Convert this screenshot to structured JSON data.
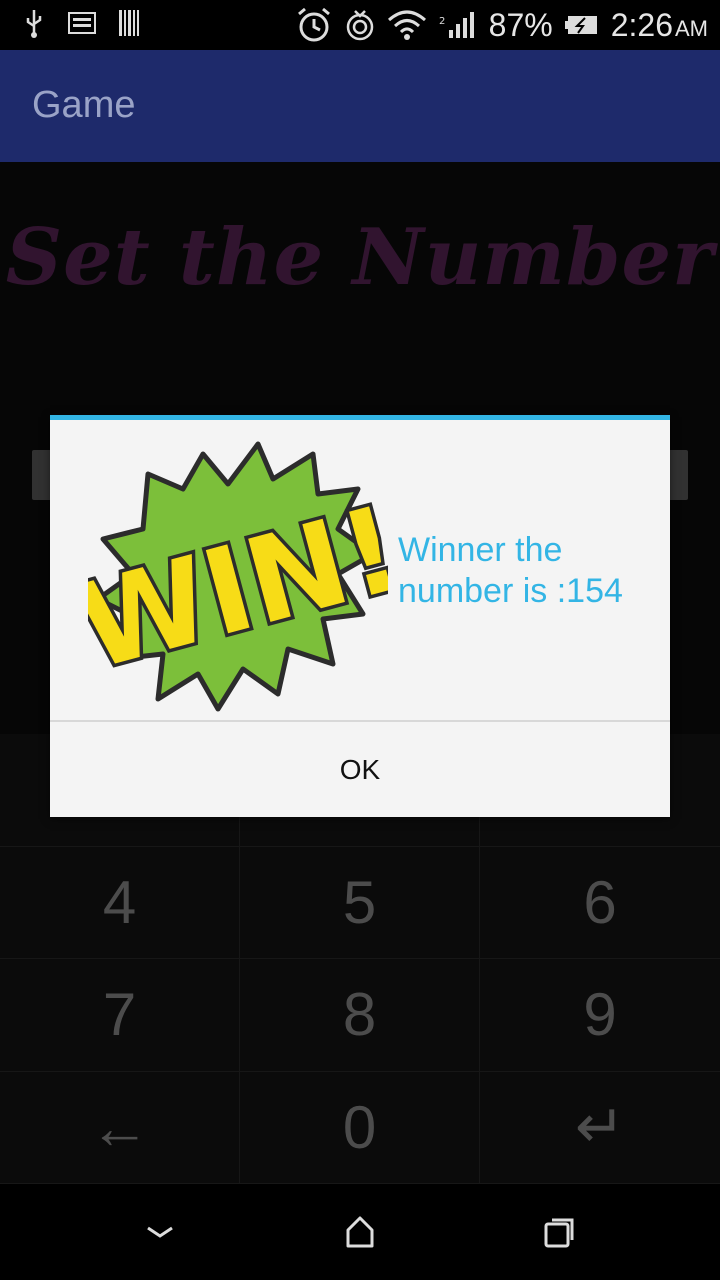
{
  "status_bar": {
    "battery": "87%",
    "time": "2:26",
    "ampm": "AM",
    "icons": [
      "usb-icon",
      "image-icon",
      "barcode-icon",
      "alarm-icon",
      "sync-icon",
      "wifi-icon",
      "signal-icon",
      "battery-icon"
    ]
  },
  "action_bar": {
    "title": "Game"
  },
  "content": {
    "headline": "Set the Number"
  },
  "keypad": {
    "keys": [
      "",
      "",
      "",
      "4",
      "5",
      "6",
      "7",
      "8",
      "9",
      "←",
      "0",
      "↵"
    ]
  },
  "dialog": {
    "image_text": "WIN!",
    "message": "Winner the number is :154",
    "ok_label": "OK",
    "accent_color": "#33b5e5"
  },
  "nav_bar": {
    "icons": [
      "back-icon",
      "home-icon",
      "recents-icon"
    ]
  }
}
